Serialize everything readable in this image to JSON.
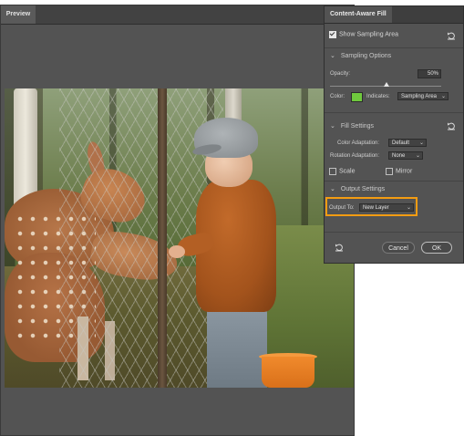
{
  "preview": {
    "tab_label": "Preview"
  },
  "panel": {
    "tab_label": "Content-Aware Fill",
    "show_sampling_area": {
      "label": "Show Sampling Area",
      "checked": true
    },
    "sampling_options": {
      "title": "Sampling Options",
      "opacity_label": "Opacity:",
      "opacity_value": "50%",
      "opacity_fraction": 0.5,
      "color_label": "Color:",
      "color_swatch": "#6fc93d",
      "indicates_label": "Indicates:",
      "indicates_value": "Sampling Area"
    },
    "fill_settings": {
      "title": "Fill Settings",
      "color_adaptation_label": "Color Adaptation:",
      "color_adaptation_value": "Default",
      "rotation_adaptation_label": "Rotation Adaptation:",
      "rotation_adaptation_value": "None",
      "scale_label": "Scale",
      "scale_checked": false,
      "mirror_label": "Mirror",
      "mirror_checked": false
    },
    "output_settings": {
      "title": "Output Settings",
      "output_to_label": "Output To:",
      "output_to_value": "New Layer",
      "highlight_color": "#f39c12"
    },
    "buttons": {
      "cancel": "Cancel",
      "ok": "OK"
    }
  }
}
